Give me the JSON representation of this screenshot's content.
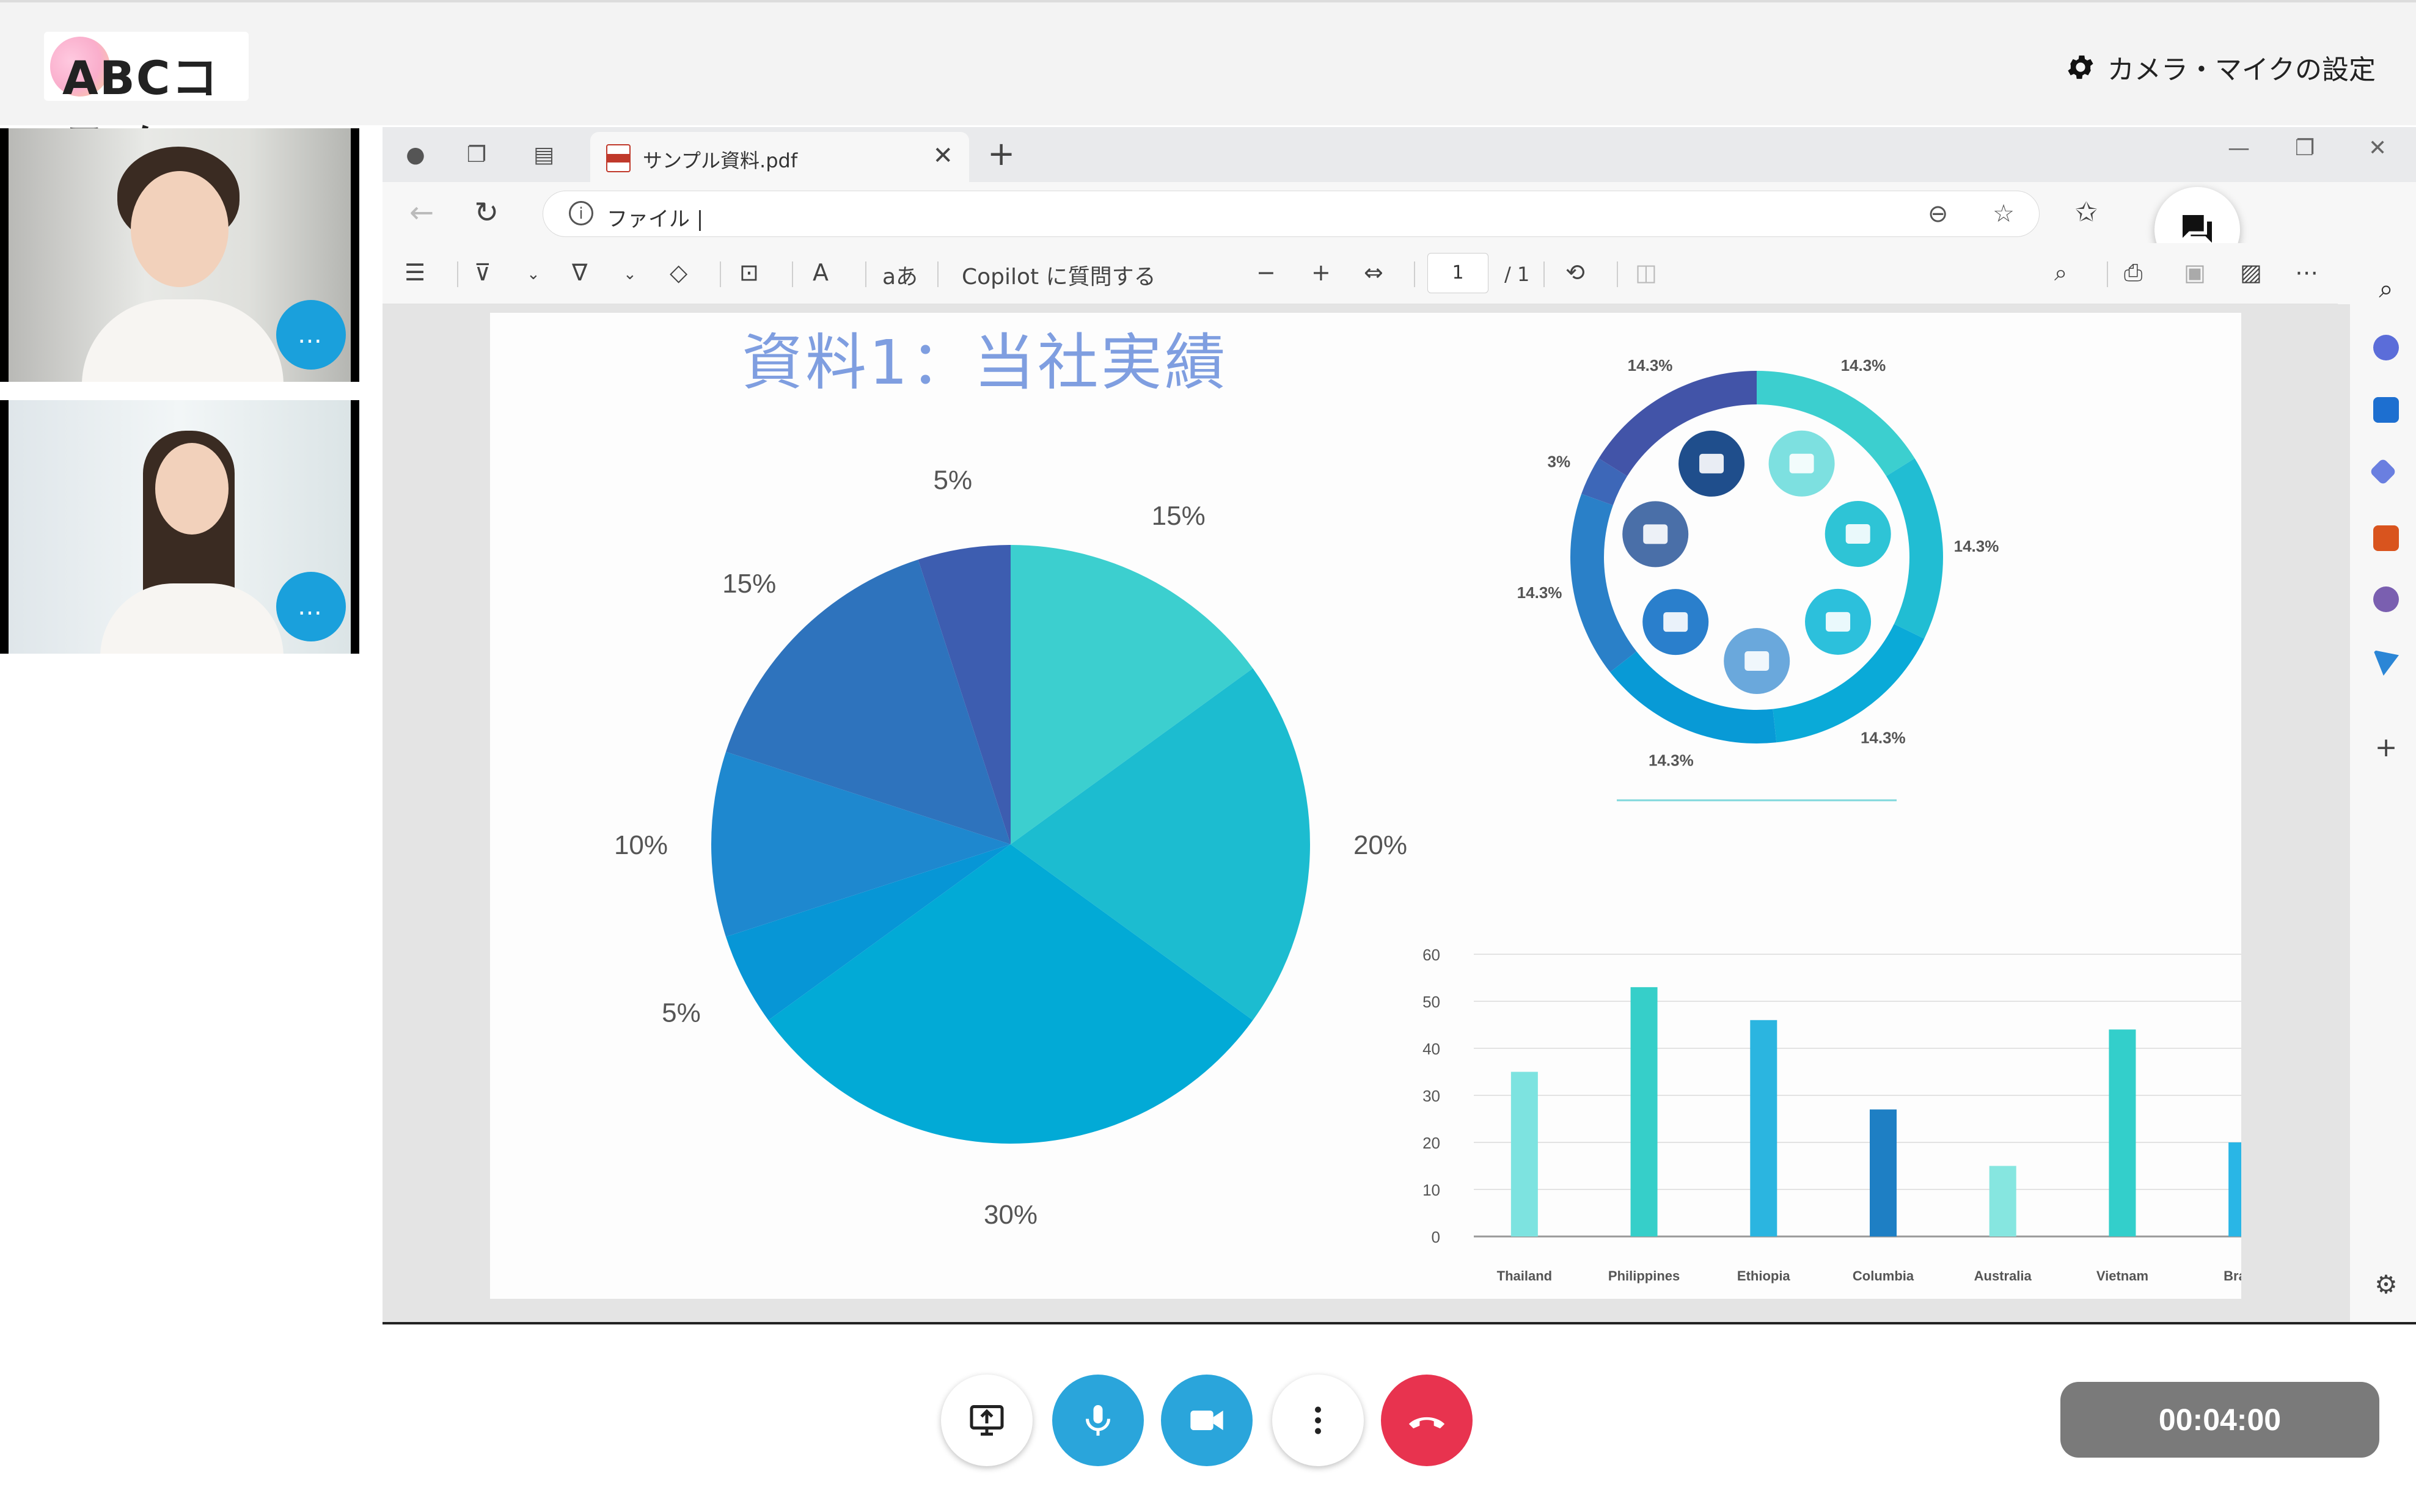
{
  "header": {
    "logo_text": "ABCコスメ",
    "camera_settings_label": "カメラ・マイクの設定"
  },
  "participants": [
    {
      "more_label": "…"
    },
    {
      "more_label": "…"
    }
  ],
  "browser": {
    "tab_title": "サンプル資料.pdf",
    "url_prefix": "ファイル",
    "pdf_toolbar": {
      "copilot_label": "Copilot に質問する",
      "read_aloud_label": "aあ",
      "page_current": "1",
      "page_total": "/ 1"
    }
  },
  "document": {
    "title": "資料1：当社実績"
  },
  "chart_data": [
    {
      "type": "pie",
      "title": "",
      "labels": [
        "15%",
        "20%",
        "30%",
        "5%",
        "10%",
        "15%",
        "5%"
      ],
      "values": [
        15,
        20,
        30,
        5,
        10,
        15,
        5
      ],
      "colors": [
        "#3ccfcf",
        "#1cbcd0",
        "#02aad6",
        "#0796d6",
        "#1e88cf",
        "#2e73bd",
        "#3d5db0"
      ]
    },
    {
      "type": "pie",
      "subtype": "donut-infographic",
      "title": "",
      "labels": [
        "14.3%",
        "14.3%",
        "14.3%",
        "14.3%",
        "14.3%",
        "3%",
        "14.3%"
      ],
      "values": [
        14.3,
        14.3,
        14.3,
        14.3,
        14.3,
        3,
        14.3
      ],
      "icons": [
        "bar-chart-icon",
        "wallet-icon",
        "document-icon",
        "check-icon",
        "briefcase-icon",
        "mail-icon",
        "download-box-icon"
      ]
    },
    {
      "type": "bar",
      "title": "",
      "categories": [
        "Thailand",
        "Philippines",
        "Ethiopia",
        "Columbia",
        "Australia",
        "Vietnam",
        "Brazil"
      ],
      "values": [
        35,
        53,
        46,
        27,
        15,
        44,
        20
      ],
      "ylim": [
        0,
        60
      ],
      "yticks": [
        0,
        10,
        20,
        30,
        40,
        50,
        60
      ],
      "grid": true,
      "colors": [
        "#7de3e0",
        "#36cfc9",
        "#2bb5e0",
        "#1e7fc4",
        "#86e6e0",
        "#33cfcb",
        "#29b6e6"
      ]
    }
  ],
  "controls": {
    "timer": "00:04:00"
  }
}
